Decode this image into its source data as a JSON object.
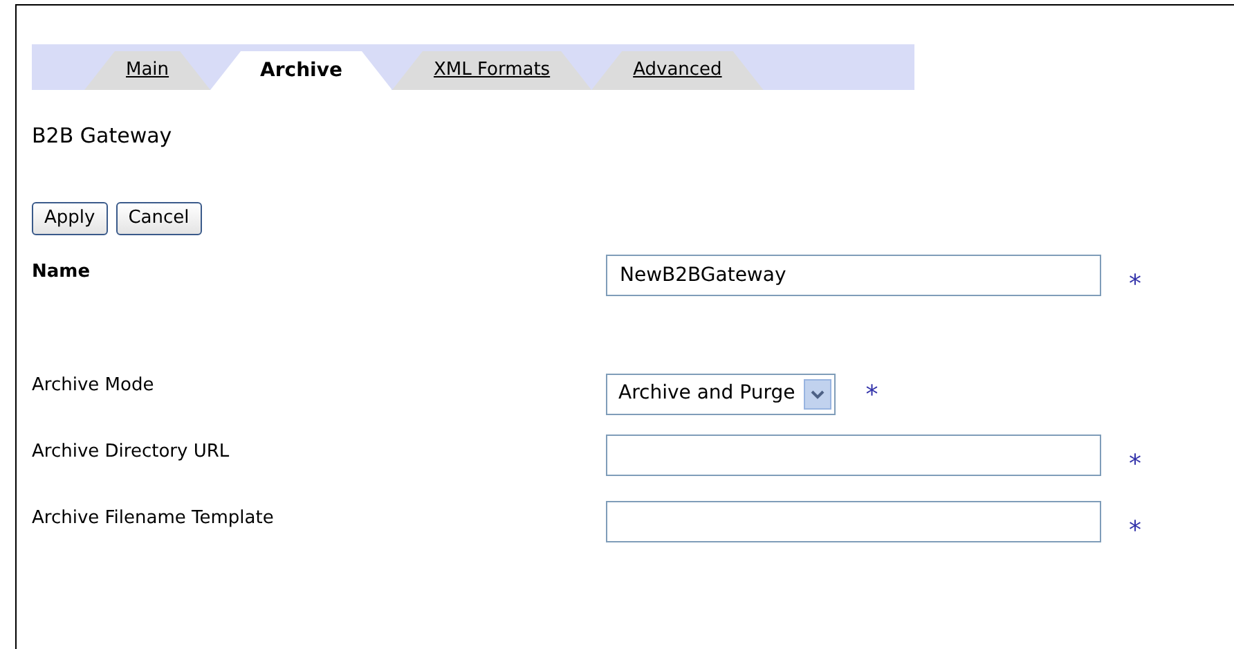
{
  "tabs": [
    {
      "label": "Main",
      "selected": false
    },
    {
      "label": "Archive",
      "selected": true
    },
    {
      "label": "XML Formats",
      "selected": false
    },
    {
      "label": "Advanced",
      "selected": false
    }
  ],
  "title": "B2B Gateway",
  "buttons": [
    "Apply",
    "Cancel"
  ],
  "fields": [
    {
      "kind": "text",
      "label": "Name",
      "bold": true,
      "value": "NewB2BGateway",
      "required": true
    },
    {
      "kind": "select",
      "label": "Archive Mode",
      "bold": false,
      "value": "Archive and Purge",
      "required": true
    },
    {
      "kind": "text",
      "label": "Archive Directory URL",
      "bold": false,
      "required": true
    },
    {
      "kind": "text",
      "label": "Archive Filename Template",
      "bold": false,
      "required": true
    }
  ],
  "required_mark": "*"
}
